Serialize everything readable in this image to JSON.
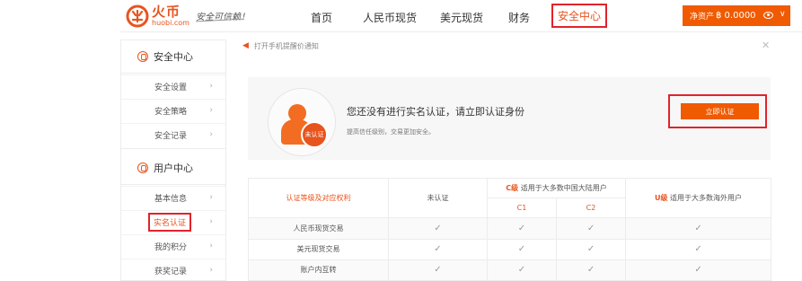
{
  "brand": {
    "name_cn": "火币",
    "name_en": "huobi.com",
    "slogan": "安全可信赖！"
  },
  "nav": {
    "items": [
      "首页",
      "人民币现货",
      "美元现货",
      "财务"
    ],
    "active": "安全中心"
  },
  "assets": {
    "label": "净资产",
    "value": "฿ 0.0000"
  },
  "sidebar": {
    "security_title": "安全中心",
    "security_items": [
      "安全设置",
      "安全策略",
      "安全记录"
    ],
    "user_title": "用户中心",
    "user_items": [
      "基本信息",
      "实名认证",
      "我的积分",
      "获奖记录"
    ],
    "active_item": "实名认证"
  },
  "notice": {
    "text": "打开手机提醒价通知"
  },
  "verify": {
    "badge": "未认证",
    "title": "您还没有进行实名认证，请立即认证身份",
    "subtitle": "提高信任级别，交易更加安全。",
    "button": "立即认证"
  },
  "table": {
    "header_main": "认证等级及对应权利",
    "col_unverified": "未认证",
    "c_level": "C级",
    "c_desc": "适用于大多数中国大陆用户",
    "c1": "C1",
    "c2": "C2",
    "u_level": "U级",
    "u_desc": "适用于大多数海外用户",
    "rows": [
      {
        "name": "人民币现货交易",
        "cells": [
          "✓",
          "✓",
          "✓",
          "✓"
        ]
      },
      {
        "name": "美元现货交易",
        "cells": [
          "✓",
          "✓",
          "✓",
          "✓"
        ]
      },
      {
        "name": "账户内互转",
        "cells": [
          "✓",
          "✓",
          "✓",
          "✓"
        ]
      }
    ]
  },
  "colors": {
    "accent": "#f05a00",
    "highlight_border": "#e1232b"
  }
}
